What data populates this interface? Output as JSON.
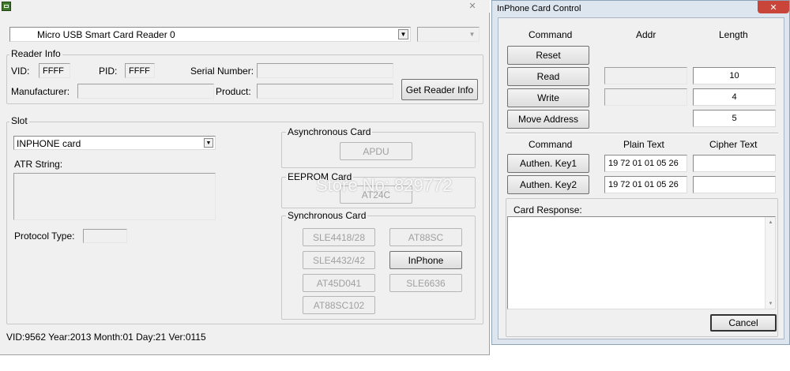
{
  "main": {
    "close_glyph": "✕",
    "reader_select": "Micro USB Smart Card Reader 0",
    "reader_info": {
      "legend": "Reader Info",
      "vid_label": "VID:",
      "vid_value": "FFFF",
      "pid_label": "PID:",
      "pid_value": "FFFF",
      "serial_label": "Serial Number:",
      "manufacturer_label": "Manufacturer:",
      "product_label": "Product:",
      "get_info_button": "Get Reader Info"
    },
    "slot": {
      "legend": "Slot",
      "card_select": "INPHONE card",
      "atr_label": "ATR String:",
      "protocol_label": "Protocol Type:",
      "async_legend": "Asynchronous Card",
      "apdu_button": "APDU",
      "eeprom_legend": "EEPROM Card",
      "at24c_button": "AT24C",
      "sync_legend": "Synchronous Card",
      "sle4418_button": "SLE4418/28",
      "at88sc_button": "AT88SC",
      "sle4432_button": "SLE4432/42",
      "inphone_button": "InPhone",
      "at45d041_button": "AT45D041",
      "sle6636_button": "SLE6636",
      "at88sc102_button": "AT88SC102"
    },
    "status_text": "VID:9562 Year:2013 Month:01 Day:21 Ver:0115",
    "watermark": "Store No: 829772"
  },
  "dialog": {
    "title": "InPhone Card Control",
    "close_glyph": "✕",
    "headers": {
      "command": "Command",
      "addr": "Addr",
      "length": "Length"
    },
    "buttons": {
      "reset": "Reset",
      "read": "Read",
      "write": "Write",
      "move": "Move Address"
    },
    "lengths": {
      "read": "10",
      "write": "4",
      "move": "5"
    },
    "auth_headers": {
      "command": "Command",
      "plain": "Plain Text",
      "cipher": "Cipher Text"
    },
    "auth": {
      "key1_button": "Authen. Key1",
      "key1_plain": "19 72 01 01 05 26",
      "key2_button": "Authen. Key2",
      "key2_plain": "19 72 01 01 05 26"
    },
    "response_label": "Card Response:",
    "cancel_button": "Cancel"
  }
}
